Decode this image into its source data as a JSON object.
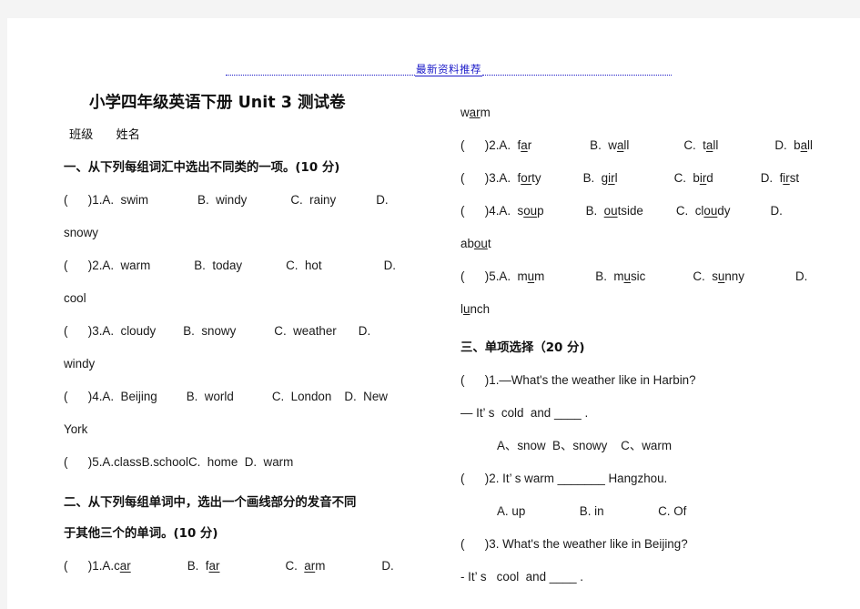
{
  "watermark": {
    "text": "最新资料推荐"
  },
  "doc": {
    "title": "小学四年级英语下册 Unit 3 测试卷",
    "info_line": "班级      姓名"
  },
  "section1": {
    "heading": "一、从下列每组词汇中选出不同类的一项。(10 分)",
    "items": [
      {
        "num": "(      )1.",
        "a": "A.  swim",
        "b": "B.  windy",
        "c": "C.  rainy",
        "d": "D.",
        "wrap": "snowy"
      },
      {
        "num": "(      )2.",
        "a": "A.  warm",
        "b": "B.  today",
        "c": "C.  hot",
        "d": "D.",
        "wrap": "cool"
      },
      {
        "num": "(      )3.",
        "a": "A.  cloudy",
        "b": "B.  snowy",
        "c": "C.  weather",
        "d": "D.",
        "wrap": "windy"
      },
      {
        "num": "(      )4.",
        "a": "A.  Beijing",
        "b": "B.  world",
        "c": "C.  London",
        "d": "D.  New",
        "wrap": "York"
      },
      {
        "num": "(      )5.",
        "a": "A.classB.schoolC.  home  D.  warm",
        "b": "",
        "c": "",
        "d": "",
        "wrap": ""
      }
    ]
  },
  "section2": {
    "heading": "二、从下列每组单词中，选出一个画线部分的发音不同\n于其他三个的单词。(10 分)",
    "items": [
      {
        "num": "(      )1.",
        "a_pre": "A.c",
        "a_u": "ar",
        "a_post": "",
        "b_pre": "B.  f",
        "b_u": "ar",
        "b_post": "",
        "c_pre": "C.  ",
        "c_u": "ar",
        "c_post": "m",
        "d_pre": "D.",
        "d_u": "",
        "d_post": "",
        "wrap_pre": "w",
        "wrap_u": "ar",
        "wrap_post": "m"
      },
      {
        "num": "(      )2.",
        "a_pre": "A.  f",
        "a_u": "a",
        "a_post": "r",
        "b_pre": "B.  w",
        "b_u": "a",
        "b_post": "ll",
        "c_pre": "C.  t",
        "c_u": "a",
        "c_post": "ll",
        "d_pre": "D.  b",
        "d_u": "a",
        "d_post": "ll",
        "wrap_pre": "",
        "wrap_u": "",
        "wrap_post": ""
      },
      {
        "num": "(      )3.",
        "a_pre": "A.  f",
        "a_u": "or",
        "a_post": "ty",
        "b_pre": "B.  g",
        "b_u": "ir",
        "b_post": "l",
        "c_pre": "C.  b",
        "c_u": "ir",
        "c_post": "d",
        "d_pre": "D.  f",
        "d_u": "ir",
        "d_post": "st",
        "wrap_pre": "",
        "wrap_u": "",
        "wrap_post": ""
      },
      {
        "num": "(      )4.",
        "a_pre": "A.  s",
        "a_u": "ou",
        "a_post": "p",
        "b_pre": "B.  ",
        "b_u": "ou",
        "b_post": "tside",
        "c_pre": "C.  cl",
        "c_u": "ou",
        "c_post": "dy",
        "d_pre": "D.",
        "d_u": "",
        "d_post": "",
        "wrap_pre": "ab",
        "wrap_u": "ou",
        "wrap_post": "t"
      },
      {
        "num": "(      )5.",
        "a_pre": "A.  m",
        "a_u": "u",
        "a_post": "m",
        "b_pre": "B.  m",
        "b_u": "u",
        "b_post": "sic",
        "c_pre": "C.  s",
        "c_u": "u",
        "c_post": "nny",
        "d_pre": "D.",
        "d_u": "",
        "d_post": "",
        "wrap_pre": "l",
        "wrap_u": "u",
        "wrap_post": "nch"
      }
    ]
  },
  "section3": {
    "heading": "三、单项选择（20 分)",
    "q1": {
      "stem": "(      )1.—What's the weather like in Harbin?",
      "answer": "— It’ s  cold  and ____ .",
      "options": "A、snow  B、snowy    C、warm"
    },
    "q2": {
      "stem": "(      )2. It’ s warm _______ Hangzhou.",
      "options": "A. up                B. in                C. Of"
    },
    "q3": {
      "stem": "(      )3. What's the weather like in Beijing?",
      "answer": "- It’ s   cool  and ____ ."
    }
  },
  "colors": {
    "watermark": "#1a19c8",
    "text": "#1a1a1a"
  }
}
